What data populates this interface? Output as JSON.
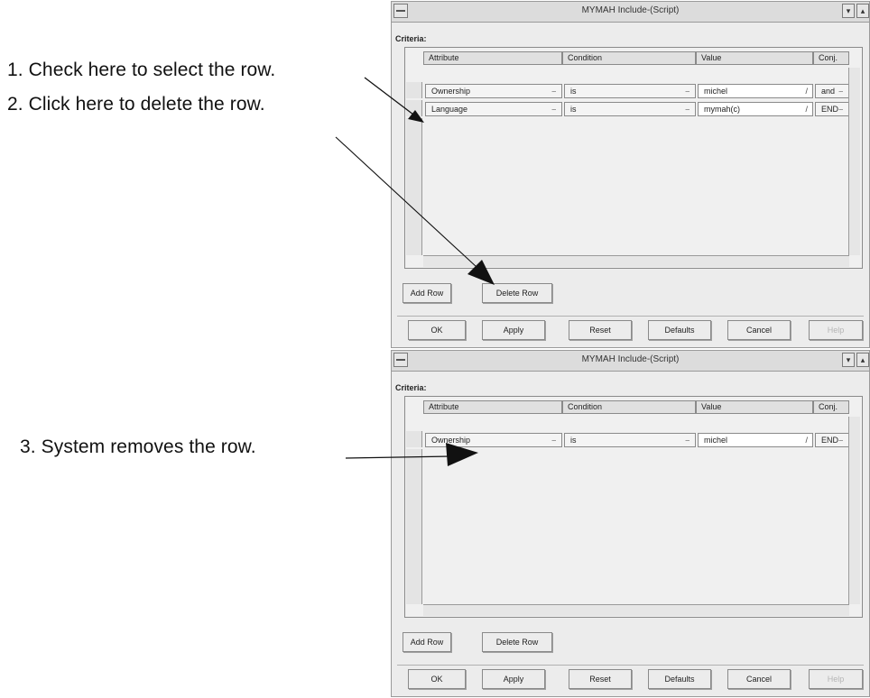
{
  "callouts": {
    "step1": "1. Check here to select the row.",
    "step2": "2. Click here to delete the row.",
    "step3": "3. System removes the row."
  },
  "window": {
    "title": "MYMAH Include-(Script)",
    "criteria_label": "Criteria:",
    "columns": {
      "attribute": "Attribute",
      "condition": "Condition",
      "value": "Value",
      "conj": "Conj."
    }
  },
  "before": {
    "rows": [
      {
        "attribute": "Ownership",
        "condition": "is",
        "value": "michel",
        "conj": "and"
      },
      {
        "attribute": "Language",
        "condition": "is",
        "value": "mymah(c)",
        "conj": "END"
      }
    ]
  },
  "after": {
    "rows": [
      {
        "attribute": "Ownership",
        "condition": "is",
        "value": "michel",
        "conj": "END"
      }
    ]
  },
  "buttons": {
    "add_row": "Add Row",
    "delete_row": "Delete Row",
    "ok": "OK",
    "apply": "Apply",
    "reset": "Reset",
    "defaults": "Defaults",
    "cancel": "Cancel",
    "help": "Help"
  }
}
